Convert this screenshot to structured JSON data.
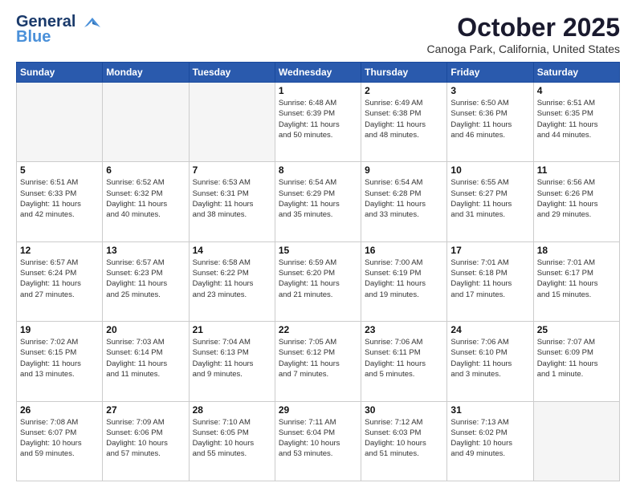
{
  "header": {
    "logo_line1": "General",
    "logo_line2": "Blue",
    "month": "October 2025",
    "location": "Canoga Park, California, United States"
  },
  "days_of_week": [
    "Sunday",
    "Monday",
    "Tuesday",
    "Wednesday",
    "Thursday",
    "Friday",
    "Saturday"
  ],
  "weeks": [
    [
      {
        "day": "",
        "info": ""
      },
      {
        "day": "",
        "info": ""
      },
      {
        "day": "",
        "info": ""
      },
      {
        "day": "1",
        "info": "Sunrise: 6:48 AM\nSunset: 6:39 PM\nDaylight: 11 hours\nand 50 minutes."
      },
      {
        "day": "2",
        "info": "Sunrise: 6:49 AM\nSunset: 6:38 PM\nDaylight: 11 hours\nand 48 minutes."
      },
      {
        "day": "3",
        "info": "Sunrise: 6:50 AM\nSunset: 6:36 PM\nDaylight: 11 hours\nand 46 minutes."
      },
      {
        "day": "4",
        "info": "Sunrise: 6:51 AM\nSunset: 6:35 PM\nDaylight: 11 hours\nand 44 minutes."
      }
    ],
    [
      {
        "day": "5",
        "info": "Sunrise: 6:51 AM\nSunset: 6:33 PM\nDaylight: 11 hours\nand 42 minutes."
      },
      {
        "day": "6",
        "info": "Sunrise: 6:52 AM\nSunset: 6:32 PM\nDaylight: 11 hours\nand 40 minutes."
      },
      {
        "day": "7",
        "info": "Sunrise: 6:53 AM\nSunset: 6:31 PM\nDaylight: 11 hours\nand 38 minutes."
      },
      {
        "day": "8",
        "info": "Sunrise: 6:54 AM\nSunset: 6:29 PM\nDaylight: 11 hours\nand 35 minutes."
      },
      {
        "day": "9",
        "info": "Sunrise: 6:54 AM\nSunset: 6:28 PM\nDaylight: 11 hours\nand 33 minutes."
      },
      {
        "day": "10",
        "info": "Sunrise: 6:55 AM\nSunset: 6:27 PM\nDaylight: 11 hours\nand 31 minutes."
      },
      {
        "day": "11",
        "info": "Sunrise: 6:56 AM\nSunset: 6:26 PM\nDaylight: 11 hours\nand 29 minutes."
      }
    ],
    [
      {
        "day": "12",
        "info": "Sunrise: 6:57 AM\nSunset: 6:24 PM\nDaylight: 11 hours\nand 27 minutes."
      },
      {
        "day": "13",
        "info": "Sunrise: 6:57 AM\nSunset: 6:23 PM\nDaylight: 11 hours\nand 25 minutes."
      },
      {
        "day": "14",
        "info": "Sunrise: 6:58 AM\nSunset: 6:22 PM\nDaylight: 11 hours\nand 23 minutes."
      },
      {
        "day": "15",
        "info": "Sunrise: 6:59 AM\nSunset: 6:20 PM\nDaylight: 11 hours\nand 21 minutes."
      },
      {
        "day": "16",
        "info": "Sunrise: 7:00 AM\nSunset: 6:19 PM\nDaylight: 11 hours\nand 19 minutes."
      },
      {
        "day": "17",
        "info": "Sunrise: 7:01 AM\nSunset: 6:18 PM\nDaylight: 11 hours\nand 17 minutes."
      },
      {
        "day": "18",
        "info": "Sunrise: 7:01 AM\nSunset: 6:17 PM\nDaylight: 11 hours\nand 15 minutes."
      }
    ],
    [
      {
        "day": "19",
        "info": "Sunrise: 7:02 AM\nSunset: 6:15 PM\nDaylight: 11 hours\nand 13 minutes."
      },
      {
        "day": "20",
        "info": "Sunrise: 7:03 AM\nSunset: 6:14 PM\nDaylight: 11 hours\nand 11 minutes."
      },
      {
        "day": "21",
        "info": "Sunrise: 7:04 AM\nSunset: 6:13 PM\nDaylight: 11 hours\nand 9 minutes."
      },
      {
        "day": "22",
        "info": "Sunrise: 7:05 AM\nSunset: 6:12 PM\nDaylight: 11 hours\nand 7 minutes."
      },
      {
        "day": "23",
        "info": "Sunrise: 7:06 AM\nSunset: 6:11 PM\nDaylight: 11 hours\nand 5 minutes."
      },
      {
        "day": "24",
        "info": "Sunrise: 7:06 AM\nSunset: 6:10 PM\nDaylight: 11 hours\nand 3 minutes."
      },
      {
        "day": "25",
        "info": "Sunrise: 7:07 AM\nSunset: 6:09 PM\nDaylight: 11 hours\nand 1 minute."
      }
    ],
    [
      {
        "day": "26",
        "info": "Sunrise: 7:08 AM\nSunset: 6:07 PM\nDaylight: 10 hours\nand 59 minutes."
      },
      {
        "day": "27",
        "info": "Sunrise: 7:09 AM\nSunset: 6:06 PM\nDaylight: 10 hours\nand 57 minutes."
      },
      {
        "day": "28",
        "info": "Sunrise: 7:10 AM\nSunset: 6:05 PM\nDaylight: 10 hours\nand 55 minutes."
      },
      {
        "day": "29",
        "info": "Sunrise: 7:11 AM\nSunset: 6:04 PM\nDaylight: 10 hours\nand 53 minutes."
      },
      {
        "day": "30",
        "info": "Sunrise: 7:12 AM\nSunset: 6:03 PM\nDaylight: 10 hours\nand 51 minutes."
      },
      {
        "day": "31",
        "info": "Sunrise: 7:13 AM\nSunset: 6:02 PM\nDaylight: 10 hours\nand 49 minutes."
      },
      {
        "day": "",
        "info": ""
      }
    ]
  ]
}
